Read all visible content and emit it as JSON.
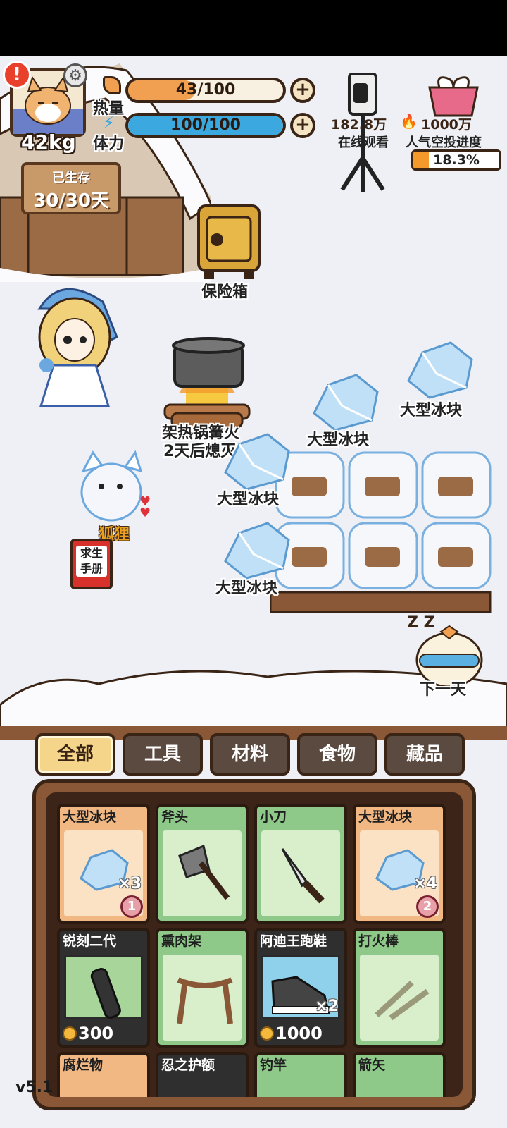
{
  "player": {
    "weight": "42kg",
    "alert": "!"
  },
  "stats": {
    "heat_label": "热量",
    "heat_value": "43/100",
    "heat_fraction": 0.43,
    "stamina_label": "体力",
    "stamina_value": "100/100",
    "stamina_fraction": 1.0,
    "plus": "+"
  },
  "live": {
    "viewers": "182.8万",
    "viewers_label": "在线观看",
    "target": "1000万",
    "airdrop_label": "人气空投进度",
    "airdrop_progress": "18.3%",
    "airdrop_fraction": 0.183
  },
  "survival": {
    "label": "已生存",
    "days": "30/30天"
  },
  "world": {
    "safe_label": "保险箱",
    "campfire_label": "架热锅篝火",
    "campfire_status": "2天后熄灭",
    "fox_label": "狐狸",
    "manual_line1": "求生",
    "manual_line2": "手册",
    "ice_labels": [
      "大型冰块",
      "大型冰块",
      "大型冰块",
      "大型冰块"
    ],
    "next_day": "下一天"
  },
  "tabs": [
    {
      "label": "全部",
      "active": true
    },
    {
      "label": "工具",
      "active": false
    },
    {
      "label": "材料",
      "active": false
    },
    {
      "label": "食物",
      "active": false
    },
    {
      "label": "藏品",
      "active": false
    }
  ],
  "inventory": [
    {
      "name": "大型冰块",
      "style": "orange",
      "count": "×3",
      "alarm": "1"
    },
    {
      "name": "斧头",
      "style": "green"
    },
    {
      "name": "小刀",
      "style": "green"
    },
    {
      "name": "大型冰块",
      "style": "orange",
      "count": "×4",
      "alarm": "2"
    },
    {
      "name": "锐刻二代",
      "style": "dark",
      "price": "300"
    },
    {
      "name": "熏肉架",
      "style": "green"
    },
    {
      "name": "阿迪王跑鞋",
      "style": "dark",
      "count": "×2",
      "price": "1000"
    },
    {
      "name": "打火棒",
      "style": "green"
    },
    {
      "name": "腐烂物",
      "style": "orange"
    },
    {
      "name": "忍之护额",
      "style": "dark"
    },
    {
      "name": "钓竿",
      "style": "green"
    },
    {
      "name": "箭矢",
      "style": "green"
    }
  ],
  "version": "v5.1",
  "colors": {
    "heat": "#f0a050",
    "stamina": "#3ba8e0",
    "frame": "#3a2416",
    "wood": "#8a5836"
  }
}
